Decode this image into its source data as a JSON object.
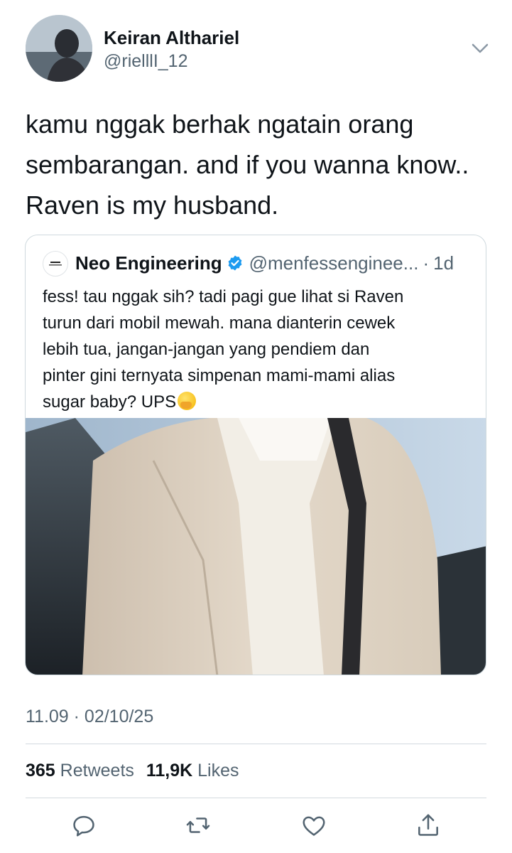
{
  "author": {
    "name": "Keiran Althariel",
    "handle": "@rielllI_12"
  },
  "icons": {
    "more": "chevron-down-icon",
    "verified": "verified-badge-icon",
    "reply": "reply-icon",
    "retweet": "retweet-icon",
    "like": "heart-icon",
    "share": "share-icon"
  },
  "tweet": {
    "lines": [
      "kamu nggak berhak ngatain orang",
      "sembarangan. and if you wanna know..",
      "Raven is my husband."
    ]
  },
  "quote": {
    "name": "Neo Engineering",
    "handle": "@menfessenginee...",
    "separator": "·",
    "time": "1d",
    "lines": [
      "fess! tau nggak sih? tadi pagi gue lihat si Raven",
      "turun dari mobil mewah. mana dianterin cewek",
      "lebih tua, jangan-jangan yang pendiem dan",
      "pinter gini ternyata simpenan mami-mami alias",
      "sugar baby? UPS"
    ]
  },
  "timestamp": "11.09 · 02/10/25",
  "stats": {
    "retweets": "365",
    "retweets_label": "Retweets",
    "likes": "11,9K",
    "likes_label": "Likes"
  },
  "colors": {
    "verified": "#1d9bf0",
    "secondary_text": "#536471",
    "border": "#cfd9de"
  }
}
